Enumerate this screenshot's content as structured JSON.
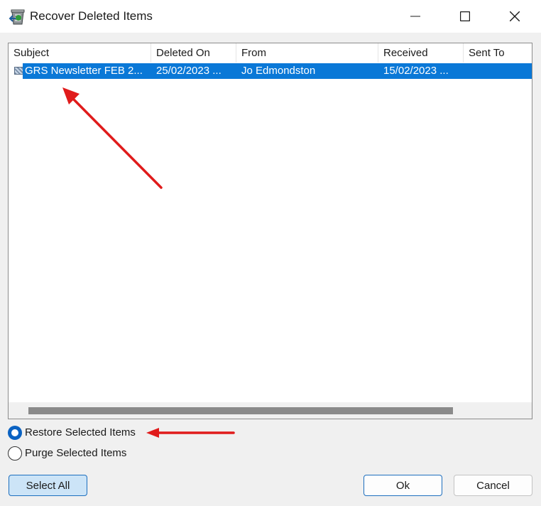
{
  "window": {
    "title": "Recover Deleted Items",
    "icon": "recycle-bin-icon",
    "controls": [
      "minimize-icon",
      "maximize-icon",
      "close-icon"
    ]
  },
  "list": {
    "columns": [
      "Subject",
      "Deleted On",
      "From",
      "Received",
      "Sent To"
    ],
    "rows": [
      {
        "icon": "mail-item-icon",
        "subject": "GRS Newsletter FEB 2...",
        "deleted_on": "25/02/2023 ...",
        "from": "Jo Edmondston",
        "received": "15/02/2023 ...",
        "sent_to": "",
        "selected": true
      }
    ],
    "selection_color": "#0a78d7"
  },
  "options": {
    "restore_label": "Restore Selected Items",
    "purge_label": "Purge Selected Items",
    "selected": "restore"
  },
  "buttons": {
    "select_all": "Select All",
    "ok": "Ok",
    "cancel": "Cancel"
  },
  "colors": {
    "accent": "#0a62c2",
    "annotation_arrow": "#e01b1b"
  }
}
